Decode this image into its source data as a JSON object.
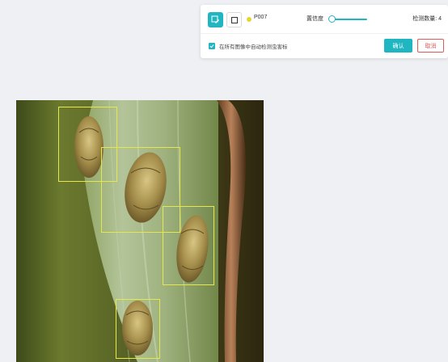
{
  "toolbar": {
    "edit_tool_icon": "edit-select-icon",
    "rect_tool_icon": "rectangle-icon",
    "class_label": "P007",
    "class_color": "#e8d42c",
    "confidence_label": "置信度",
    "confidence_value": 0.05,
    "detection_count": "检测数量: 4",
    "checkbox_checked": true,
    "checkbox_text": "在所有图像中自动检测虫害标",
    "confirm_label": "确认",
    "cancel_label": "取消",
    "accent_color": "#1fb6c1",
    "cancel_color": "#e05a5a"
  },
  "image": {
    "subject": "insects on green leaf",
    "annotation_count": 4
  }
}
